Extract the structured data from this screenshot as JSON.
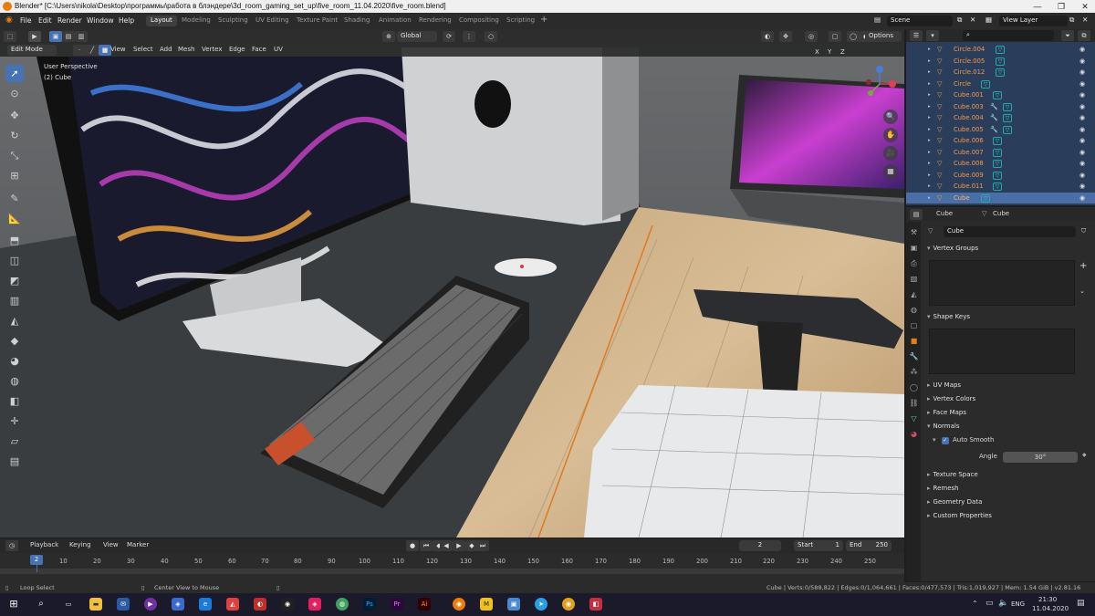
{
  "window": {
    "title": "Blender* [C:\\Users\\nikola\\Desktop\\программы\\работа в блэндере\\3d_room_gaming_set_up\\five_room_11.04.2020\\five_room.blend]"
  },
  "menu": [
    "File",
    "Edit",
    "Render",
    "Window",
    "Help"
  ],
  "workspaces": [
    "Layout",
    "Modeling",
    "Sculpting",
    "UV Editing",
    "Texture Paint",
    "Shading",
    "Animation",
    "Rendering",
    "Compositing",
    "Scripting"
  ],
  "active_workspace": "Layout",
  "scene": {
    "name": "Scene",
    "view_layer": "View Layer"
  },
  "viewport": {
    "mode": "Edit Mode",
    "menus": [
      "View",
      "Select",
      "Add",
      "Mesh",
      "Vertex",
      "Edge",
      "Face",
      "UV"
    ],
    "orientation": "Global",
    "options": "Options",
    "overlay_line1": "User Perspective",
    "overlay_line2": "(2) Cube",
    "gizmo": {
      "x": "X",
      "y": "Y",
      "z": "Z"
    }
  },
  "outliner": {
    "items": [
      {
        "name": "Circle.004",
        "wrench": false
      },
      {
        "name": "Circle.005",
        "wrench": false
      },
      {
        "name": "Circle.012",
        "wrench": false
      },
      {
        "name": "Circle",
        "wrench": false
      },
      {
        "name": "Cube.001",
        "wrench": false
      },
      {
        "name": "Cube.003",
        "wrench": true
      },
      {
        "name": "Cube.004",
        "wrench": true
      },
      {
        "name": "Cube.005",
        "wrench": true
      },
      {
        "name": "Cube.006",
        "wrench": false
      },
      {
        "name": "Cube.007",
        "wrench": false
      },
      {
        "name": "Cube.008",
        "wrench": false
      },
      {
        "name": "Cube.009",
        "wrench": false
      },
      {
        "name": "Cube.011",
        "wrench": false
      },
      {
        "name": "Cube",
        "wrench": false
      }
    ]
  },
  "properties": {
    "object_name": "Cube",
    "mesh_name": "Cube",
    "datablock": "Cube",
    "sections": {
      "vertex_groups": "Vertex Groups",
      "shape_keys": "Shape Keys",
      "uv_maps": "UV Maps",
      "vertex_colors": "Vertex Colors",
      "face_maps": "Face Maps",
      "normals": "Normals",
      "auto_smooth": "Auto Smooth",
      "angle_label": "Angle",
      "angle_value": "30°",
      "texture_space": "Texture Space",
      "remesh": "Remesh",
      "geometry_data": "Geometry Data",
      "custom_properties": "Custom Properties"
    }
  },
  "timeline": {
    "menus": [
      "Playback",
      "Keying",
      "View",
      "Marker"
    ],
    "current_frame": "2",
    "start_label": "Start",
    "start": "1",
    "end_label": "End",
    "end": "250",
    "ticks": [
      "2",
      "10",
      "20",
      "30",
      "40",
      "50",
      "60",
      "70",
      "80",
      "90",
      "100",
      "110",
      "120",
      "130",
      "140",
      "150",
      "160",
      "170",
      "180",
      "190",
      "200",
      "210",
      "220",
      "230",
      "240",
      "250"
    ]
  },
  "statusbar": {
    "left1": "Loop Select",
    "left2": "Center View to Mouse",
    "stats": "Cube | Verts:0/588,822 | Edges:0/1,064,661 | Faces:0/477,573 | Tris:1,019,927 | Mem: 1.54 GiB | v2.81.16"
  },
  "taskbar": {
    "lang": "ENG",
    "time": "21:30",
    "date": "11.04.2020"
  }
}
